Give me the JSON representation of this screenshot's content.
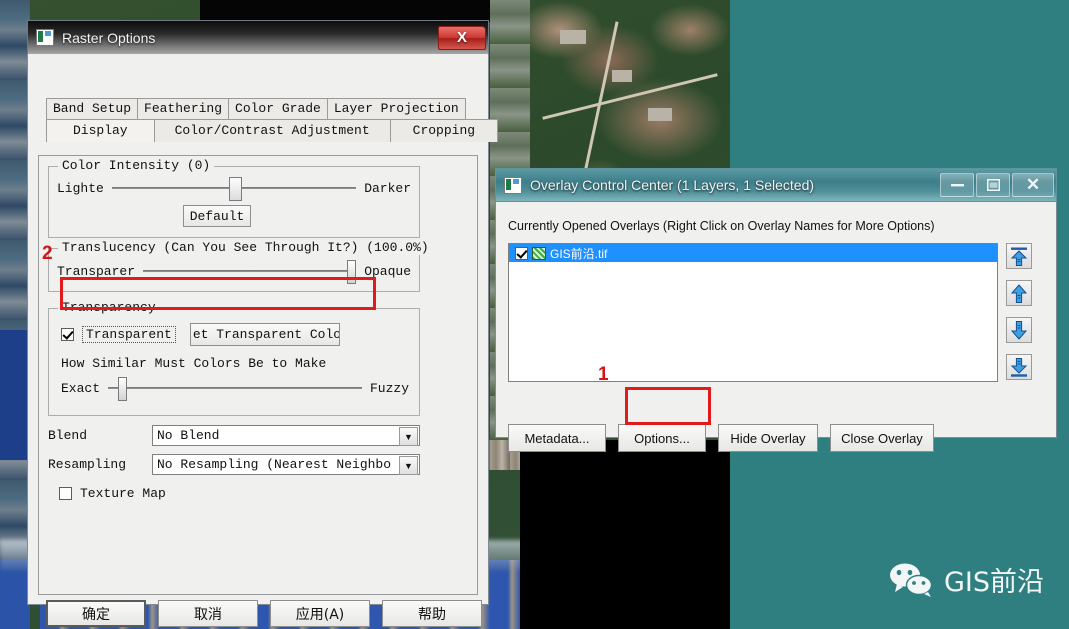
{
  "raster_options": {
    "title": "Raster Options",
    "icon": "app-icon",
    "close_label": "X",
    "tabs_row1": [
      {
        "label": "Band Setup",
        "selected": false
      },
      {
        "label": "Feathering",
        "selected": false
      },
      {
        "label": "Color Grade",
        "selected": false
      },
      {
        "label": "Layer Projection",
        "selected": false
      }
    ],
    "tabs_row2": [
      {
        "label": "Display",
        "selected": true
      },
      {
        "label": "Color/Contrast Adjustment",
        "selected": false
      },
      {
        "label": "Cropping",
        "selected": false
      }
    ],
    "color_intensity": {
      "legend": "Color Intensity (0)",
      "left_label": "Lighte",
      "right_label": "Darker",
      "default_button": "Default",
      "thumb_percent": 50
    },
    "translucency": {
      "legend": "Translucency (Can You See Through It?) (100.0%)",
      "left_label": "Transparer",
      "right_label": "Opaque",
      "thumb_percent": 100
    },
    "transparency": {
      "legend": "Transparency",
      "checkbox_label": "Transparent",
      "checkbox_checked": true,
      "set_color_button": "et Transparent Color..",
      "similarity_text": "How Similar Must Colors Be to Make",
      "exact_label": "Exact",
      "fuzzy_label": "Fuzzy",
      "thumb_percent": 4
    },
    "blend": {
      "label": "Blend",
      "value": "No Blend"
    },
    "resampling": {
      "label": "Resampling",
      "value": "No Resampling (Nearest Neighbo"
    },
    "texture_map": {
      "label": "Texture Map",
      "checked": false
    },
    "footer_buttons": [
      {
        "label": "确定",
        "default": true
      },
      {
        "label": "取消",
        "default": false
      },
      {
        "label": "应用(A)",
        "default": false
      },
      {
        "label": "帮助",
        "default": false
      }
    ]
  },
  "overlay_control_center": {
    "title": "Overlay Control Center (1 Layers, 1 Selected)",
    "minimize_label": "—",
    "maximize_label": "▭",
    "close_label": "✕",
    "hint": "Currently Opened Overlays (Right Click on Overlay Names for More Options)",
    "layers": [
      {
        "name": "GIS前沿.tif",
        "checked": true,
        "selected": true
      }
    ],
    "order_buttons": [
      {
        "name": "move-to-top-arrow-icon",
        "glyph": "⬆"
      },
      {
        "name": "move-up-arrow-icon",
        "glyph": "⬆"
      },
      {
        "name": "move-down-arrow-icon",
        "glyph": "⬇"
      },
      {
        "name": "move-to-bottom-arrow-icon",
        "glyph": "⬇"
      }
    ],
    "footer_buttons": [
      {
        "label": "Metadata..."
      },
      {
        "label": "Options..."
      },
      {
        "label": "Hide Overlay"
      },
      {
        "label": "Close Overlay"
      }
    ]
  },
  "annotations": [
    {
      "number": "1",
      "target": "options-button"
    },
    {
      "number": "2",
      "target": "transparency-group"
    }
  ],
  "watermark": {
    "text": "GIS前沿",
    "icon": "wechat-icon"
  },
  "colors": {
    "accent_red": "#e01b1b",
    "selection_blue": "#1e90ff",
    "desktop_teal": "#2f7f80",
    "dialog_face": "#f0f0ee"
  }
}
